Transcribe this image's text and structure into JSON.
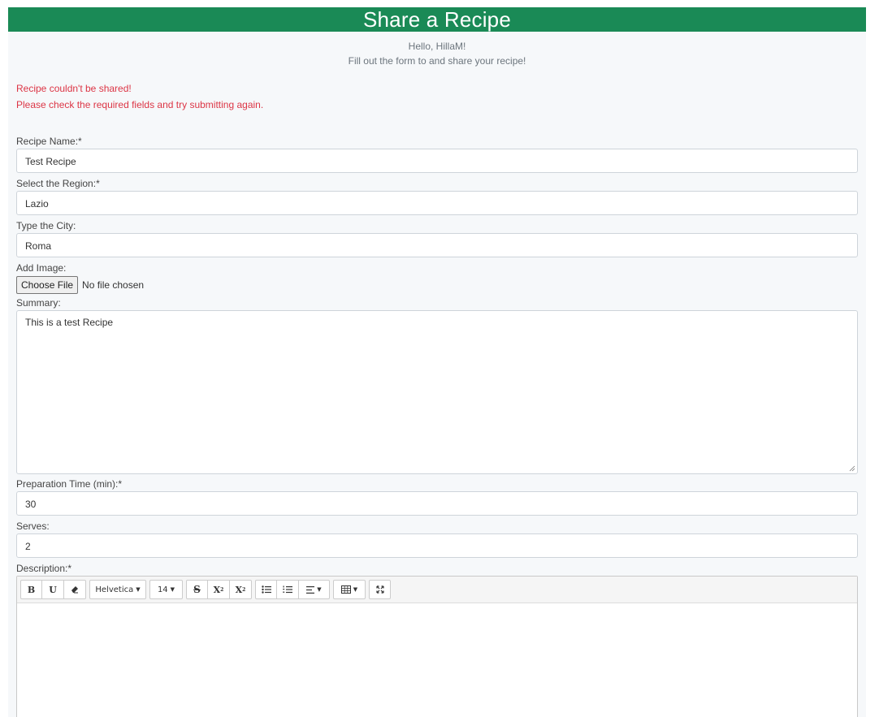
{
  "banner": {
    "title": "Share a Recipe"
  },
  "greeting": {
    "hello": "Hello, HillaM!",
    "instruction": "Fill out the form to and share your recipe!"
  },
  "errors": {
    "line1": "Recipe couldn't be shared!",
    "line2": "Please check the required fields and try submitting again."
  },
  "form": {
    "recipe_name": {
      "label": "Recipe Name:*",
      "value": "Test Recipe"
    },
    "region": {
      "label": "Select the Region:*",
      "value": "Lazio"
    },
    "city": {
      "label": "Type the City:",
      "value": "Roma"
    },
    "image": {
      "label": "Add Image:",
      "button": "Choose File",
      "status": "No file chosen"
    },
    "summary": {
      "label": "Summary:",
      "value": "This is a test Recipe"
    },
    "prep_time": {
      "label": "Preparation Time (min):*",
      "value": "30"
    },
    "serves": {
      "label": "Serves:",
      "value": "2"
    },
    "description": {
      "label": "Description:*",
      "value": ""
    }
  },
  "editor": {
    "bold": "B",
    "underline": "U",
    "font_family": "Helvetica",
    "font_size": "14",
    "strike": "S",
    "superscript": "X",
    "subscript": "X"
  },
  "colors": {
    "banner": "#1a8a56",
    "error": "#dc3545"
  }
}
